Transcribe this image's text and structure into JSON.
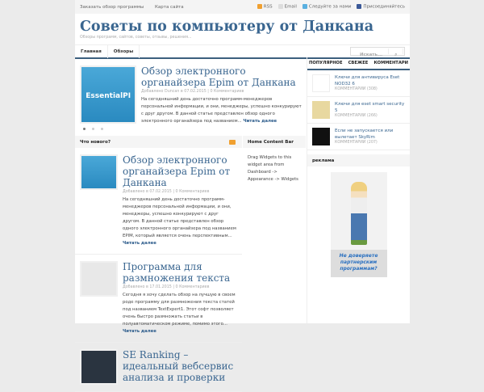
{
  "topbar": {
    "links": [
      "Заказать обзор программы",
      "Карта сайта"
    ],
    "rss": "RSS",
    "email": "Email",
    "twitter": "Следуйте за нами",
    "facebook": "Присоединяйтесь"
  },
  "header": {
    "title": "Советы по компьютеру от Данкана",
    "tagline": "Обзоры программ, сайтов, советы, отзывы, решения..."
  },
  "nav": {
    "items": [
      "Главная",
      "Обзоры"
    ],
    "search_placeholder": "Искать..."
  },
  "featured": {
    "title": "Обзор электронного органайзера Epim от Данкана",
    "meta": "Добавлено Duncan в 07.02.2015",
    "comments": "0 Комментариев",
    "excerpt": "На сегодняшний день достаточно программ-менеджеров персональной информации, и они, менеджеры, успешно конкурируют с друг другом. В данной статье представлен обзор одного электронного органайзера под названием...",
    "more": "Читать далее",
    "thumb_text": "EssentialPI"
  },
  "whatsnew": {
    "heading": "Что нового?",
    "posts": [
      {
        "title": "Обзор электронного органайзера Epim от Данкана",
        "meta": "Добавлено в 07.02.2015",
        "comments": "0 Комментариев",
        "excerpt": "На сегодняшний день достаточно программ-менеджеров персональной информации, и они, менеджеры, успешно конкурируют с друг другом. В данной статье представлен обзор одного электронного органайзера под названием EPIM, который является очень перспективным...",
        "more": "Читать далее"
      },
      {
        "title": "Программа для размножения текста",
        "meta": "Добавлено в 17.01.2015",
        "comments": "0 Комментариев",
        "excerpt": "Сегодня я хочу сделать обзор на лучшую в своем роде программу для размножения текста статей под названием TextExpert1. Этот софт позволяет очень быстро размножать статьи в полуавтоматическом режиме, помимо этого...",
        "more": "Читать далее"
      },
      {
        "title": "SE Ranking – идеальный вебсервис анализа и проверки"
      }
    ]
  },
  "contentbar": {
    "heading": "Home Content Bar",
    "text": "Drag Widgets to this widget area from Dashboard -> Appearance -> Widgets"
  },
  "sidebar": {
    "tabs": [
      "ПОПУЛЯРНОЕ",
      "СВЕЖЕЕ",
      "КОММЕНТАРИ"
    ],
    "popular": [
      {
        "title": "Ключи для антивируса Eset NOD32 6",
        "comments": "КОММЕНТАРИИ (308)"
      },
      {
        "title": "Ключи для eset smart security 5",
        "comments": "КОММЕНТАРИИ (266)"
      },
      {
        "title": "Если не запускается или вылетает SkyRim",
        "comments": "КОММЕНТАРИИ (207)"
      }
    ],
    "ad_heading": "реклама",
    "ad_text": "Не доверяете партнерским программам?"
  }
}
